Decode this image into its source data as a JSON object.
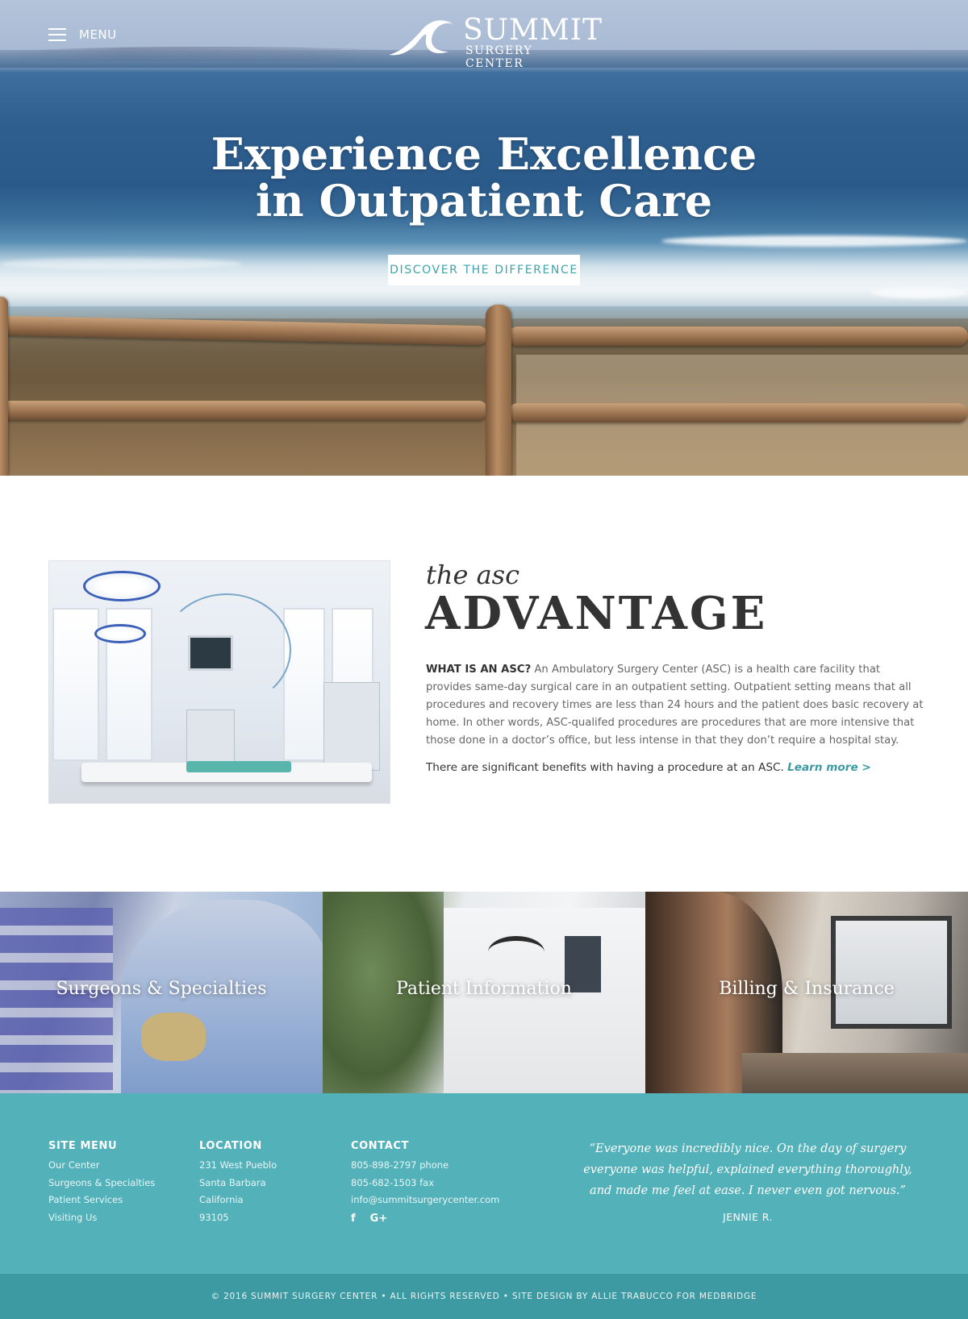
{
  "header": {
    "menu_label": "MENU",
    "logo_name": "SUMMIT",
    "logo_subtitle": "SURGERY CENTER"
  },
  "hero": {
    "title_line1": "Experience Excellence",
    "title_line2": "in Outpatient Care",
    "cta_label": "DISCOVER THE DIFFERENCE"
  },
  "asc": {
    "kicker": "the asc",
    "heading": "ADVANTAGE",
    "lead": "WHAT IS AN ASC?",
    "body": " An Ambulatory Surgery Center (ASC) is a health care facility that provides same-day surgical care in an outpatient setting. Outpatient setting means that all procedures and recovery times are less than 24 hours and the patient does basic recovery at home. In other words, ASC-qualifed procedures are procedures that are more intensive that those done in a doctor’s office, but less intense in that they don’t require a hospital stay.",
    "benefit": "There are significant benefits with having a procedure at an ASC. ",
    "learn_more": "Learn more >"
  },
  "tiles": [
    {
      "label": "Surgeons & Specialties"
    },
    {
      "label": "Patient Information"
    },
    {
      "label": "Billing & Insurance"
    }
  ],
  "footer": {
    "site_menu": {
      "heading": "SITE MENU",
      "items": [
        "Our Center",
        "Surgeons & Specialties",
        "Patient Services",
        "Visiting Us"
      ]
    },
    "location": {
      "heading": "LOCATION",
      "lines": [
        "231 West Pueblo",
        "Santa Barbara",
        "California",
        "93105"
      ]
    },
    "contact": {
      "heading": "CONTACT",
      "phone": "805-898-2797 phone",
      "fax": "805-682-1503 fax",
      "email": "info@summitsurgerycenter.com",
      "social": [
        "facebook-icon",
        "google-plus-icon"
      ]
    },
    "testimonial": {
      "quote": "“Everyone was incredibly nice. On the day of surgery everyone was helpful, explained everything thoroughly, and made me feel at ease. I never even got nervous.”",
      "author": "JENNIE R."
    },
    "copyright": "© 2016 SUMMIT SURGERY CENTER • ALL RIGHTS RESERVED • SITE DESIGN BY ALLIE TRABUCCO FOR MEDBRIDGE"
  },
  "colors": {
    "teal": "#53b1b9",
    "teal_dark": "#3e9aa2",
    "link": "#3c9aa2",
    "heading": "#333333"
  }
}
